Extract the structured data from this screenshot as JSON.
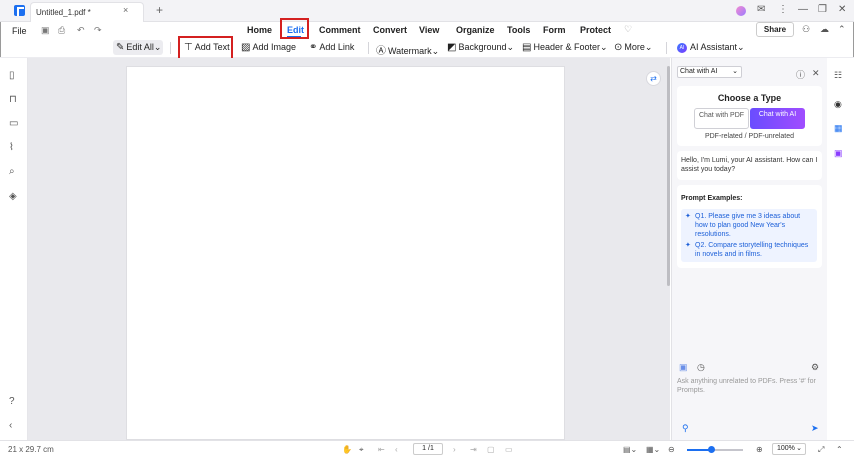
{
  "titlebar": {
    "tab_title": "Untitled_1.pdf *",
    "tab_close": "×",
    "new_tab": "+",
    "icons": {
      "avatar": "avatar-icon",
      "mail": "✉",
      "menu": "⋮",
      "minimize": "—",
      "restore": "❐",
      "close": "✕"
    }
  },
  "menubar": {
    "file": "File",
    "items": [
      "Home",
      "Edit",
      "Comment",
      "Convert",
      "View",
      "Organize",
      "Tools",
      "Form",
      "Protect"
    ],
    "share": "Share"
  },
  "toolbar": {
    "edit_all": "Edit All",
    "add_text": "Add Text",
    "add_image": "Add Image",
    "add_link": "Add Link",
    "watermark": "Watermark",
    "background": "Background",
    "header_footer": "Header & Footer",
    "more": "More",
    "ai_badge": "AI",
    "ai_assistant": "AI Assistant",
    "caret": "⌄"
  },
  "ai_panel": {
    "mode_select": "Chat with AI",
    "choose_type": "Choose a Type",
    "option_pdf": "Chat with PDF",
    "option_ai": "Chat with AI",
    "type_sub": "PDF-related / PDF-unrelated",
    "greeting": "Hello, I'm Lumi, your AI assistant. How can I assist you today?",
    "prompts_title": "Prompt Examples:",
    "prompts": [
      "Q1. Please give me 3 ideas about how to plan good New Year's resolutions.",
      "Q2. Compare storytelling techniques in novels and in films."
    ],
    "input_placeholder": "Ask anything unrelated to PDFs. Press '#' for Prompts."
  },
  "statusbar": {
    "page_size": "21 x 29.7 cm",
    "page_indicator": "1 /1",
    "zoom": "100%",
    "zoom_level": 0.42
  }
}
